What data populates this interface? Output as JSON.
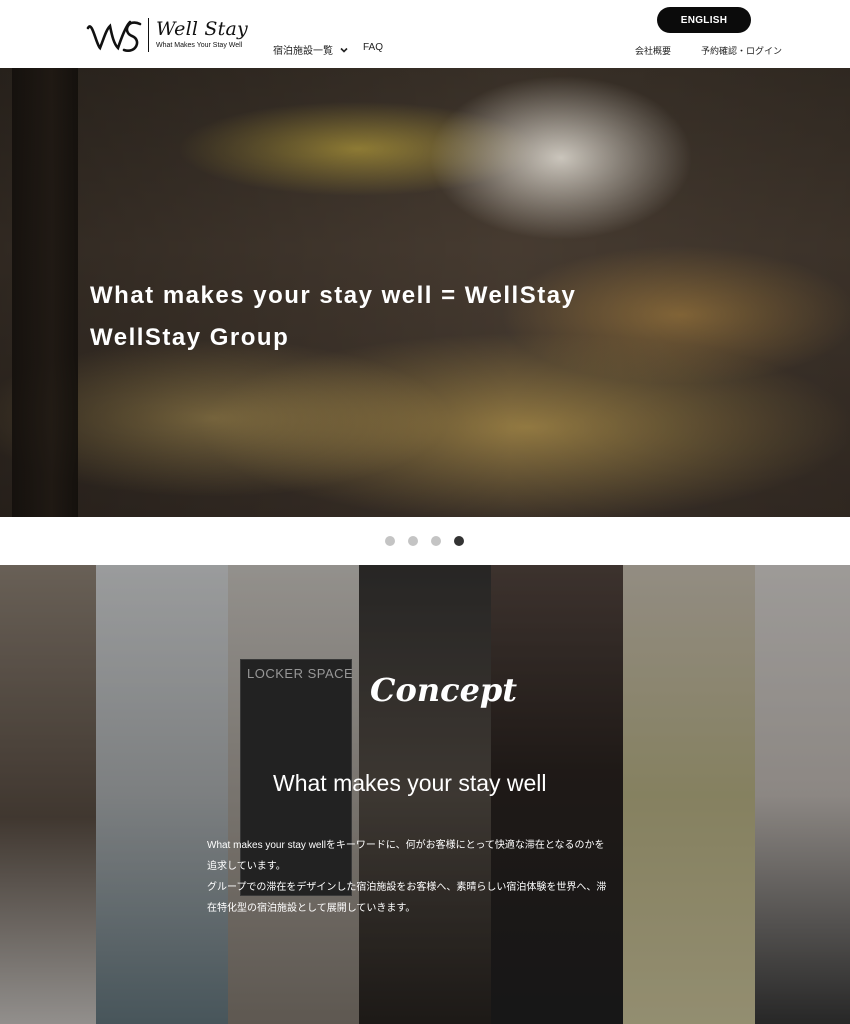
{
  "header": {
    "logo_mark": "WS",
    "logo_name": "Well Stay",
    "logo_tagline": "What Makes Your Stay Well",
    "nav": {
      "facilities_label": "宿泊施設一覧",
      "faq_label": "FAQ"
    },
    "language_button": "ENGLISH",
    "utility": {
      "company_label": "会社概要",
      "login_label": "予約確認・ログイン"
    }
  },
  "hero": {
    "line1": "What makes your stay well = WellStay",
    "line2": "WellStay Group"
  },
  "carousel": {
    "total": 4,
    "active_index": 3
  },
  "concept": {
    "locker_sign": "LOCKER SPACE",
    "script_title": "Concept",
    "heading": "What makes your stay well",
    "body_lines": [
      "What makes your stay wellをキーワードに、何がお客様にとって快適な滞在となるのかを",
      "追求しています。",
      "グループでの滞在をデザインした宿泊施設をお客様へ、素晴らしい宿泊体験を世界へ、滞",
      "在特化型の宿泊施設として展開していきます。"
    ]
  },
  "colors": {
    "button_bg": "#0b0b0b",
    "dot_active": "#333333",
    "dot_inactive": "#c4c4c4"
  },
  "icons": {
    "facilities_chevron": "chevron-down-icon"
  }
}
